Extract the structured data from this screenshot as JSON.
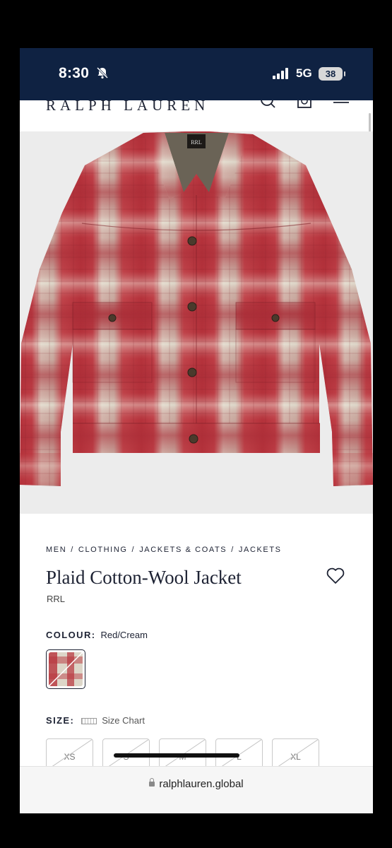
{
  "status": {
    "time": "8:30",
    "network": "5G",
    "battery": "38"
  },
  "header": {
    "brand": "RALPH LAUREN"
  },
  "breadcrumb": [
    "MEN",
    "CLOTHING",
    "JACKETS & COATS",
    "JACKETS"
  ],
  "product": {
    "title": "Plaid Cotton-Wool Jacket",
    "sub_brand": "RRL",
    "colour_label": "COLOUR:",
    "colour_value": "Red/Cream",
    "size_label": "SIZE:",
    "size_chart": "Size Chart",
    "sizes": [
      "XS",
      "S",
      "M",
      "L",
      "XL"
    ]
  },
  "browser": {
    "url": "ralphlauren.global"
  },
  "colors": {
    "status_bar": "#0f2242",
    "text": "#1d2233",
    "plaid_red": "#b8333c",
    "plaid_cream": "#ddd6c8"
  },
  "icons": [
    "bell-slash-icon",
    "signal-icon",
    "search-icon",
    "bag-icon",
    "menu-icon",
    "heart-icon",
    "ruler-icon",
    "lock-icon"
  ]
}
